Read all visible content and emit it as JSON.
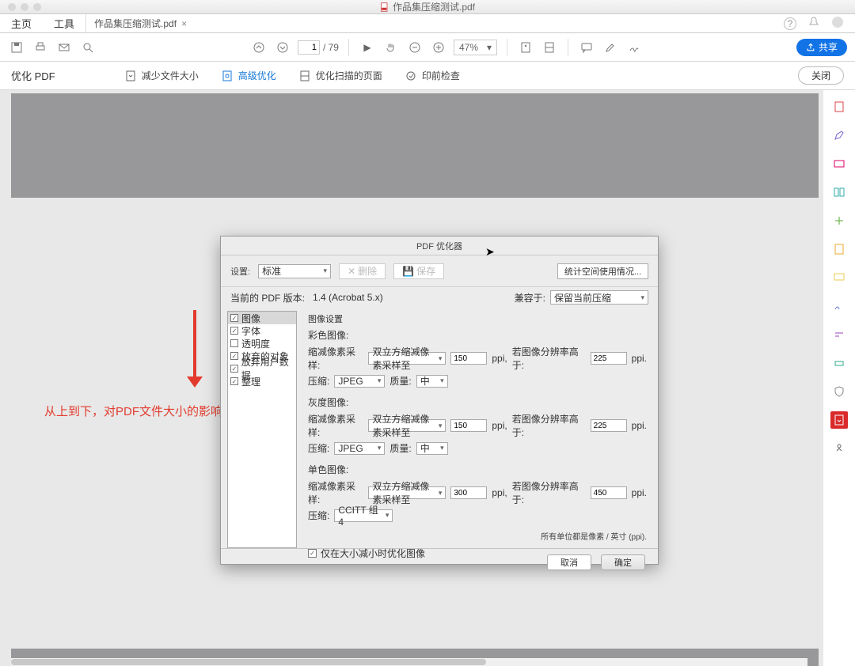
{
  "window_title": "作品集压缩测试.pdf",
  "menu": {
    "home": "主页",
    "tools": "工具"
  },
  "tab": {
    "name": "作品集压缩测试.pdf"
  },
  "help": "?",
  "toolbar": {
    "page_current": "1",
    "page_total": "/ 79",
    "zoom": "47%",
    "share": "共享"
  },
  "sub": {
    "title": "优化 PDF",
    "items": [
      {
        "label": "减少文件大小"
      },
      {
        "label": "高级优化"
      },
      {
        "label": "优化扫描的页面"
      },
      {
        "label": "印前检查"
      }
    ],
    "close": "关闭"
  },
  "annotation_text": "从上到下，对PDF文件大小的影响逐渐变小",
  "dialog": {
    "title": "PDF 优化器",
    "row1": {
      "settings_label": "设置:",
      "preset": "标准",
      "delete": "删除",
      "save": "保存",
      "stats": "统计空间使用情况..."
    },
    "row2": {
      "version_label": "当前的 PDF 版本:",
      "version_value": "1.4 (Acrobat 5.x)",
      "compat_label": "兼容于:",
      "compat_value": "保留当前压缩"
    },
    "sidebar": [
      {
        "label": "图像",
        "checked": true
      },
      {
        "label": "字体",
        "checked": true
      },
      {
        "label": "透明度",
        "checked": false
      },
      {
        "label": "放弃的对象",
        "checked": true
      },
      {
        "label": "放弃用户数据",
        "checked": true
      },
      {
        "label": "整理",
        "checked": true
      }
    ],
    "content": {
      "heading": "图像设置",
      "color": {
        "title": "彩色图像:",
        "downsample_label": "缩减像素采样:",
        "downsample_method": "双立方缩减像素采样至",
        "ppi_val": "150",
        "ppi_unit": "ppi,",
        "above_label": "若图像分辨率高于:",
        "above_val": "225",
        "above_unit": "ppi.",
        "compress_label": "压缩:",
        "compress_val": "JPEG",
        "quality_label": "质量:",
        "quality_val": "中"
      },
      "gray": {
        "title": "灰度图像:",
        "downsample_label": "缩减像素采样:",
        "downsample_method": "双立方缩减像素采样至",
        "ppi_val": "150",
        "ppi_unit": "ppi,",
        "above_label": "若图像分辨率高于:",
        "above_val": "225",
        "above_unit": "ppi.",
        "compress_label": "压缩:",
        "compress_val": "JPEG",
        "quality_label": "质量:",
        "quality_val": "中"
      },
      "mono": {
        "title": "单色图像:",
        "downsample_label": "缩减像素采样:",
        "downsample_method": "双立方缩减像素采样至",
        "ppi_val": "300",
        "ppi_unit": "ppi,",
        "above_label": "若图像分辨率高于:",
        "above_val": "450",
        "above_unit": "ppi.",
        "compress_label": "压缩:",
        "compress_val": "CCITT 组 4"
      },
      "units_note": "所有单位都是像素 / 英寸 (ppi).",
      "only_reduce": "仅在大小减小时优化图像"
    },
    "footer": {
      "cancel": "取消",
      "ok": "确定"
    }
  }
}
